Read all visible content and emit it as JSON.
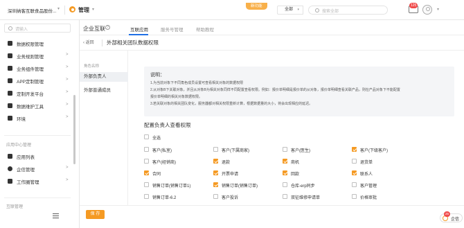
{
  "topbar": {
    "company": "深圳纳客互联食品股份...",
    "module": "管理",
    "new_feature_badge": "新功能",
    "search_scope": "全部",
    "search_placeholder": "搜索全部",
    "message_count": "125",
    "accent_color": "#f59a23"
  },
  "sidebar": {
    "search_placeholder": "请输入",
    "items": [
      {
        "label": "数据权限管理",
        "icon": "lock-icon",
        "arrow": ""
      },
      {
        "label": "业务规则管理",
        "icon": "wrench-icon",
        "arrow": ">"
      },
      {
        "label": "业务组件管理",
        "icon": "puzzle-icon",
        "arrow": ">"
      },
      {
        "label": "APP定制管理",
        "icon": "rocket-icon",
        "arrow": ">"
      },
      {
        "label": "定制开发平台",
        "icon": "monitor-icon",
        "arrow": ">"
      },
      {
        "label": "数据维护工具",
        "icon": "tool-icon",
        "arrow": ">"
      },
      {
        "label": "环境",
        "icon": "screen-icon",
        "arrow": ">"
      }
    ],
    "group_app_center": "应用中心管理",
    "app_items": [
      {
        "label": "应用列表",
        "icon": "grid-icon",
        "arrow": ""
      },
      {
        "label": "企信管理",
        "icon": "chat-icon",
        "arrow": ">"
      },
      {
        "label": "工作圈管理",
        "icon": "circle-icon",
        "arrow": ">"
      }
    ],
    "group_internet": "互联管理"
  },
  "panel": {
    "title": "企业互联",
    "tabs": [
      "互联应用",
      "服务号管理",
      "帮助教程"
    ],
    "active_tab": "互联应用",
    "back_label": "返回",
    "subtitle": "外部相关团队数据权限",
    "roles_header": "角色名称",
    "roles": [
      "外部负责人",
      "外部普通成员"
    ],
    "active_role": "外部负责人",
    "desc_title": "说明：",
    "desc_lines": [
      "1.为当前对象下不同角色成员设置可查看相关对象的数据权限",
      "2.从对象B下关联对象，并且从对象B为相关对象同样不同配置查看权限。例如：报价单明细是报价单的从对象，报价单明细查看关联产品，则在产品对象下不能配置",
      "报价单明细的相关对象数据权限。",
      "3.若关联对象的相关团队变化，服务器都对相关权限重新计算，根据数据量的大小，将会出现相应的延迟。"
    ],
    "config_title": "配置负责人查看权限",
    "select_all": "全选",
    "checkbox_rows": [
      [
        {
          "label": "客户(私室)",
          "checked": false
        },
        {
          "label": "客户(下属商家)",
          "checked": false
        },
        {
          "label": "客户(医生)",
          "checked": false
        },
        {
          "label": "客户(下级客户)",
          "checked": true
        }
      ],
      [
        {
          "label": "客户(经销商)",
          "checked": false
        },
        {
          "label": "退款",
          "checked": true
        },
        {
          "label": "商机",
          "checked": true
        },
        {
          "label": "退货单",
          "checked": false
        }
      ],
      [
        {
          "label": "合同",
          "checked": true
        },
        {
          "label": "开票申请",
          "checked": true
        },
        {
          "label": "回款",
          "checked": true
        },
        {
          "label": "联系人",
          "checked": true
        }
      ],
      [
        {
          "label": "销售订单(销售订单1)",
          "checked": false
        },
        {
          "label": "销售订单(销售订单)",
          "checked": true
        },
        {
          "label": "仓库-erp同步",
          "checked": false
        },
        {
          "label": "客户管理",
          "checked": false
        }
      ],
      [
        {
          "label": "销售订单-6.2",
          "checked": false
        },
        {
          "label": "客户投诉",
          "checked": false
        },
        {
          "label": "双征维修申请单",
          "checked": false
        },
        {
          "label": "价格审批",
          "checked": false
        }
      ]
    ]
  },
  "footer": {
    "save_label": "保 存"
  },
  "chat": {
    "label": "企信",
    "badge": "25"
  }
}
